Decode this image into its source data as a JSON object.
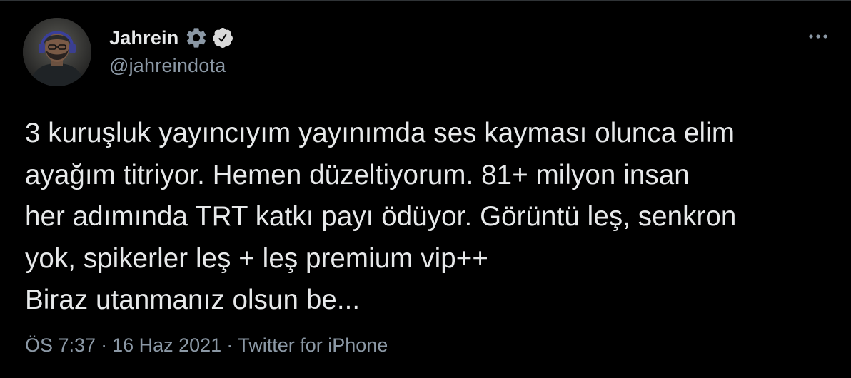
{
  "author": {
    "display_name": "Jahrein",
    "handle": "@jahreindota",
    "badges": [
      "gear-icon",
      "verified-badge-icon"
    ]
  },
  "tweet": {
    "text": "3 kuruşluk yayıncıyım yayınımda ses kayması olunca elim\nayağım titriyor. Hemen düzeltiyorum. 81+ milyon insan\nher adımında TRT katkı payı ödüyor. Görüntü leş, senkron\nyok, spikerler leş + leş premium vip++\nBiraz utanmanız olsun be..."
  },
  "meta": {
    "time": "ÖS 7:37",
    "separator": "·",
    "date": "16 Haz 2021",
    "source": "Twitter for iPhone"
  },
  "menu": {
    "more_icon": "more-options-icon"
  },
  "colors": {
    "background": "#000000",
    "primary_text": "#e7e9ea",
    "secondary_text": "#8b98a5",
    "verified_badge": "#d9d9d9"
  }
}
